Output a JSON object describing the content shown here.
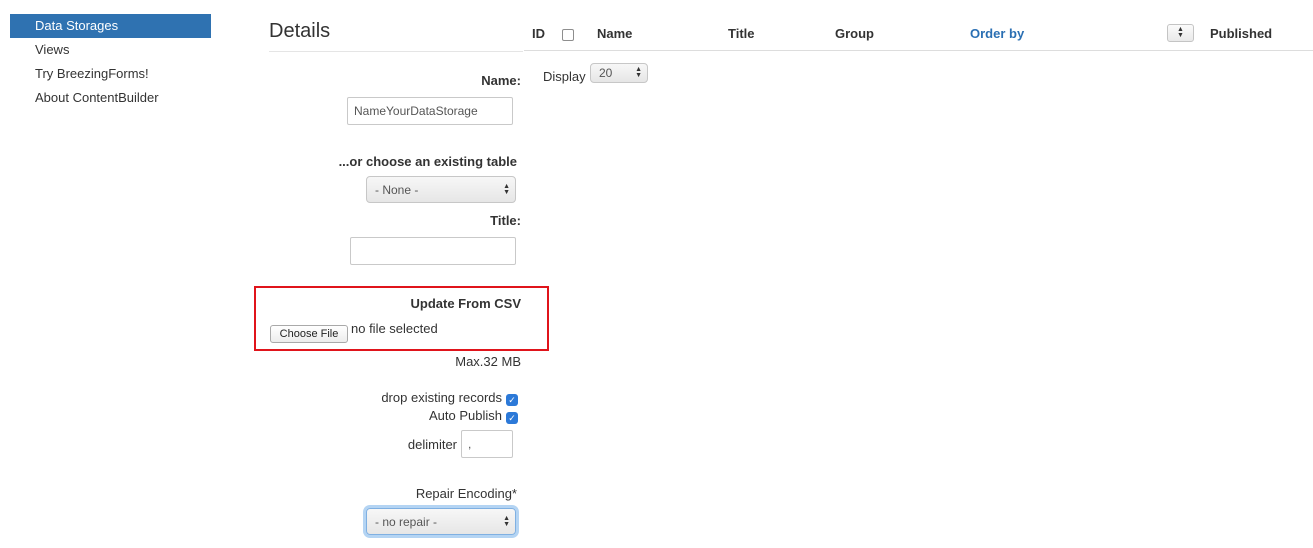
{
  "sidebar": {
    "items": [
      {
        "label": "Data Storages"
      },
      {
        "label": "Views"
      },
      {
        "label": "Try BreezingForms!"
      },
      {
        "label": "About ContentBuilder"
      }
    ]
  },
  "details": {
    "title": "Details",
    "name_label": "Name:",
    "name_value": "NameYourDataStorage",
    "existing_table_label": "...or choose an existing table",
    "existing_table_value": "- None -",
    "title_label": "Title:",
    "title_value": "",
    "csv_label": "Update From CSV",
    "choose_file_label": "Choose File",
    "file_status": "no file selected",
    "max_size": "Max.32 MB",
    "drop_existing_label": "drop existing records",
    "drop_existing_checked": true,
    "auto_publish_label": "Auto Publish",
    "auto_publish_checked": true,
    "delimiter_label": "delimiter",
    "delimiter_value": ",",
    "repair_encoding_label": "Repair Encoding*",
    "repair_encoding_value": "- no repair -"
  },
  "table": {
    "columns": {
      "id": "ID",
      "name": "Name",
      "title": "Title",
      "group": "Group",
      "order_by": "Order by",
      "published": "Published"
    },
    "display_label": "Display",
    "display_value": "20"
  },
  "colors": {
    "active_sidebar": "#2f72b1",
    "highlight_box": "#e0141b",
    "link": "#2a6fb3",
    "checkbox": "#2c79d8"
  }
}
